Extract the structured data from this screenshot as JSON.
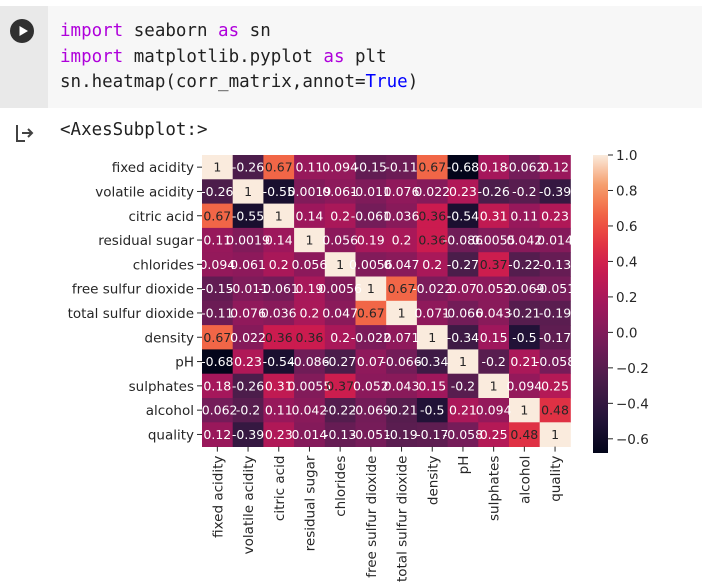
{
  "code_cell": {
    "lines": [
      {
        "kw": "import",
        "rest_a": " seaborn ",
        "kw2": "as",
        "rest_b": " sn"
      },
      {
        "kw": "import",
        "rest_a": " matplotlib.pyplot ",
        "kw2": "as",
        "rest_b": " plt"
      },
      {
        "prefix": "sn.heatmap(corr_matrix,annot=",
        "kw": "True",
        "suffix": ")"
      }
    ]
  },
  "output": {
    "text": "<AxesSubplot:>"
  },
  "chart_data": {
    "type": "heatmap",
    "labels": [
      "fixed acidity",
      "volatile acidity",
      "citric acid",
      "residual sugar",
      "chlorides",
      "free sulfur dioxide",
      "total sulfur dioxide",
      "density",
      "pH",
      "sulphates",
      "alcohol",
      "quality"
    ],
    "cells": [
      [
        "1",
        "-0.26",
        "0.67",
        "0.11",
        "0.094",
        "-0.15",
        "-0.11",
        "0.67",
        "-0.68",
        "0.18",
        "-0.062",
        "0.12"
      ],
      [
        "-0.26",
        "1",
        "-0.55",
        "0.0019",
        "0.061",
        "-0.011",
        "0.076",
        "0.022",
        "0.23",
        "-0.26",
        "-0.2",
        "-0.39"
      ],
      [
        "0.67",
        "-0.55",
        "1",
        "0.14",
        "0.2",
        "-0.061",
        "0.036",
        "0.36",
        "-0.54",
        "0.31",
        "0.11",
        "0.23"
      ],
      [
        "0.11",
        "0.0019",
        "0.14",
        "1",
        "0.056",
        "0.19",
        "0.2",
        "0.36",
        "-0.086",
        "0.0055",
        "0.042",
        "0.014"
      ],
      [
        "0.094",
        "0.061",
        "0.2",
        "0.056",
        "1",
        "0.0056",
        "0.047",
        "0.2",
        "-0.27",
        "0.37",
        "-0.22",
        "-0.13"
      ],
      [
        "-0.15",
        "-0.011",
        "-0.061",
        "0.19",
        "0.0056",
        "1",
        "0.67",
        "-0.022",
        "0.07",
        "0.052",
        "-0.069",
        "-0.051"
      ],
      [
        "-0.11",
        "0.076",
        "0.036",
        "0.2",
        "0.047",
        "0.67",
        "1",
        "0.071",
        "-0.066",
        "0.043",
        "-0.21",
        "-0.19"
      ],
      [
        "0.67",
        "0.022",
        "0.36",
        "0.36",
        "0.2",
        "-0.022",
        "0.071",
        "1",
        "-0.34",
        "0.15",
        "-0.5",
        "-0.17"
      ],
      [
        "-0.68",
        "0.23",
        "-0.54",
        "-0.086",
        "-0.27",
        "0.07",
        "-0.066",
        "-0.34",
        "1",
        "-0.2",
        "0.21",
        "-0.058"
      ],
      [
        "0.18",
        "-0.26",
        "0.31",
        "0.0055",
        "0.37",
        "0.052",
        "0.043",
        "0.15",
        "-0.2",
        "1",
        "0.094",
        "0.25"
      ],
      [
        "-0.062",
        "-0.2",
        "0.11",
        "0.042",
        "-0.22",
        "-0.069",
        "-0.21",
        "-0.5",
        "0.21",
        "0.094",
        "1",
        "0.48"
      ],
      [
        "0.12",
        "-0.39",
        "0.23",
        "0.014",
        "-0.13",
        "-0.051",
        "-0.19",
        "-0.17",
        "-0.058",
        "0.25",
        "0.48",
        "1"
      ]
    ],
    "colorbar": {
      "range": [
        -0.68,
        1.0
      ],
      "ticks": [
        "1.0",
        "0.8",
        "0.6",
        "0.4",
        "0.2",
        "0.0",
        "−0.2",
        "−0.4",
        "−0.6"
      ],
      "tick_values": [
        1.0,
        0.8,
        0.6,
        0.4,
        0.2,
        0.0,
        -0.2,
        -0.4,
        -0.6
      ]
    },
    "colormap": "rocket",
    "colors": {
      "annot_dark_text": "#262626",
      "annot_light_text": "#ffffff"
    }
  },
  "icons": {
    "run": "play-icon",
    "output": "output-arrow-icon"
  },
  "colors": {
    "keyword": "#af00db",
    "boolean": "#0000ff",
    "code_bg": "#f7f7f7",
    "gutter_bg": "#e9e9e9"
  }
}
